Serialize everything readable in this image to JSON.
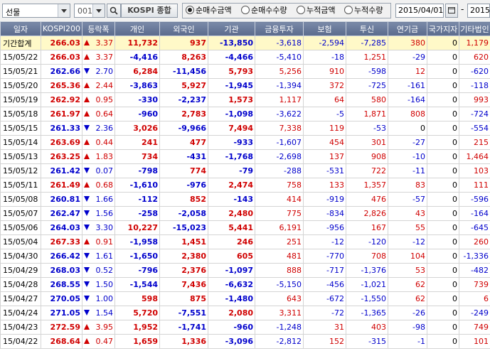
{
  "toolbar": {
    "market_select": "선물",
    "code_value": "001",
    "index_button": "KOSPI 종합",
    "radios": [
      {
        "label": "순매수금액",
        "selected": true
      },
      {
        "label": "순매수수량",
        "selected": false
      },
      {
        "label": "누적금액",
        "selected": false
      },
      {
        "label": "누적수량",
        "selected": false
      }
    ],
    "start_date": "2015/04/01",
    "range_sep": "-",
    "end_date": "2015"
  },
  "columns": [
    "일자",
    "KOSPI200",
    "등락폭",
    "개인",
    "외국인",
    "기관",
    "금융투자",
    "보험",
    "투신",
    "연기금",
    "국가지자",
    "기타법인"
  ],
  "total_row": {
    "date": "기간합계",
    "kospi": "266.03",
    "dir": "up",
    "chg": "3.37",
    "vals": [
      "11,732",
      "937",
      "-13,850",
      "-3,618",
      "-2,594",
      "-7,285",
      "380",
      "0",
      "1,179"
    ]
  },
  "rows": [
    {
      "date": "15/05/22",
      "kospi": "266.03",
      "dir": "up",
      "chg": "3.37",
      "vals": [
        "-4,416",
        "8,263",
        "-4,466",
        "-5,410",
        "-18",
        "1,251",
        "-29",
        "0",
        "620"
      ]
    },
    {
      "date": "15/05/21",
      "kospi": "262.66",
      "dir": "dn",
      "chg": "2.70",
      "vals": [
        "6,284",
        "-11,456",
        "5,793",
        "5,256",
        "910",
        "-598",
        "12",
        "0",
        "-620"
      ]
    },
    {
      "date": "15/05/20",
      "kospi": "265.36",
      "dir": "up",
      "chg": "2.44",
      "vals": [
        "-3,863",
        "5,927",
        "-1,945",
        "-1,394",
        "372",
        "-725",
        "-161",
        "0",
        "-118"
      ]
    },
    {
      "date": "15/05/19",
      "kospi": "262.92",
      "dir": "up",
      "chg": "0.95",
      "vals": [
        "-330",
        "-2,237",
        "1,573",
        "1,117",
        "64",
        "580",
        "-164",
        "0",
        "993"
      ]
    },
    {
      "date": "15/05/18",
      "kospi": "261.97",
      "dir": "up",
      "chg": "0.64",
      "vals": [
        "-960",
        "2,783",
        "-1,098",
        "-3,622",
        "-5",
        "1,871",
        "808",
        "0",
        "-724"
      ]
    },
    {
      "date": "15/05/15",
      "kospi": "261.33",
      "dir": "dn",
      "chg": "2.36",
      "vals": [
        "3,026",
        "-9,966",
        "7,494",
        "7,338",
        "119",
        "-53",
        "0",
        "0",
        "-554"
      ]
    },
    {
      "date": "15/05/14",
      "kospi": "263.69",
      "dir": "up",
      "chg": "0.44",
      "vals": [
        "241",
        "477",
        "-933",
        "-1,607",
        "454",
        "301",
        "-27",
        "0",
        "215"
      ]
    },
    {
      "date": "15/05/13",
      "kospi": "263.25",
      "dir": "up",
      "chg": "1.83",
      "vals": [
        "734",
        "-431",
        "-1,768",
        "-2,698",
        "137",
        "908",
        "-10",
        "0",
        "1,464"
      ]
    },
    {
      "date": "15/05/12",
      "kospi": "261.42",
      "dir": "dn",
      "chg": "0.07",
      "vals": [
        "-798",
        "774",
        "-79",
        "-288",
        "-531",
        "722",
        "-11",
        "0",
        "103"
      ]
    },
    {
      "date": "15/05/11",
      "kospi": "261.49",
      "dir": "up",
      "chg": "0.68",
      "vals": [
        "-1,610",
        "-976",
        "2,474",
        "758",
        "133",
        "1,357",
        "83",
        "0",
        "111"
      ]
    },
    {
      "date": "15/05/08",
      "kospi": "260.81",
      "dir": "dn",
      "chg": "1.66",
      "vals": [
        "-112",
        "852",
        "-143",
        "414",
        "-919",
        "476",
        "-57",
        "0",
        "-596"
      ]
    },
    {
      "date": "15/05/07",
      "kospi": "262.47",
      "dir": "dn",
      "chg": "1.56",
      "vals": [
        "-258",
        "-2,058",
        "2,480",
        "775",
        "-834",
        "2,826",
        "43",
        "0",
        "-164"
      ]
    },
    {
      "date": "15/05/06",
      "kospi": "264.03",
      "dir": "dn",
      "chg": "3.30",
      "vals": [
        "10,227",
        "-15,023",
        "5,441",
        "6,191",
        "-956",
        "167",
        "55",
        "0",
        "-645"
      ]
    },
    {
      "date": "15/05/04",
      "kospi": "267.33",
      "dir": "up",
      "chg": "0.91",
      "vals": [
        "-1,958",
        "1,451",
        "246",
        "251",
        "-12",
        "-120",
        "-12",
        "0",
        "260"
      ]
    },
    {
      "date": "15/04/30",
      "kospi": "266.42",
      "dir": "dn",
      "chg": "1.61",
      "vals": [
        "-1,650",
        "2,380",
        "605",
        "481",
        "-770",
        "708",
        "104",
        "0",
        "-1,336"
      ]
    },
    {
      "date": "15/04/29",
      "kospi": "268.03",
      "dir": "dn",
      "chg": "0.52",
      "vals": [
        "-796",
        "2,376",
        "-1,097",
        "888",
        "-717",
        "-1,376",
        "53",
        "0",
        "-482"
      ]
    },
    {
      "date": "15/04/28",
      "kospi": "268.55",
      "dir": "dn",
      "chg": "1.50",
      "vals": [
        "-1,544",
        "7,436",
        "-6,632",
        "-5,150",
        "-456",
        "-1,021",
        "62",
        "0",
        "739"
      ]
    },
    {
      "date": "15/04/27",
      "kospi": "270.05",
      "dir": "dn",
      "chg": "1.00",
      "vals": [
        "598",
        "875",
        "-1,480",
        "643",
        "-672",
        "-1,550",
        "62",
        "0",
        "6"
      ]
    },
    {
      "date": "15/04/24",
      "kospi": "271.05",
      "dir": "dn",
      "chg": "1.54",
      "vals": [
        "5,720",
        "-7,551",
        "2,080",
        "3,311",
        "-72",
        "-1,365",
        "-26",
        "0",
        "-249"
      ]
    },
    {
      "date": "15/04/23",
      "kospi": "272.59",
      "dir": "up",
      "chg": "3.95",
      "vals": [
        "1,952",
        "-1,741",
        "-960",
        "-1,248",
        "31",
        "403",
        "-98",
        "0",
        "749"
      ]
    },
    {
      "date": "15/04/22",
      "kospi": "268.64",
      "dir": "up",
      "chg": "0.47",
      "vals": [
        "1,659",
        "1,336",
        "-3,096",
        "-2,812",
        "152",
        "-315",
        "-1",
        "0",
        "101"
      ]
    }
  ],
  "colors": {
    "up": "#d00000",
    "down": "#0000cc",
    "header": "#6a7a9a",
    "total_bg": "#fff9c8"
  }
}
